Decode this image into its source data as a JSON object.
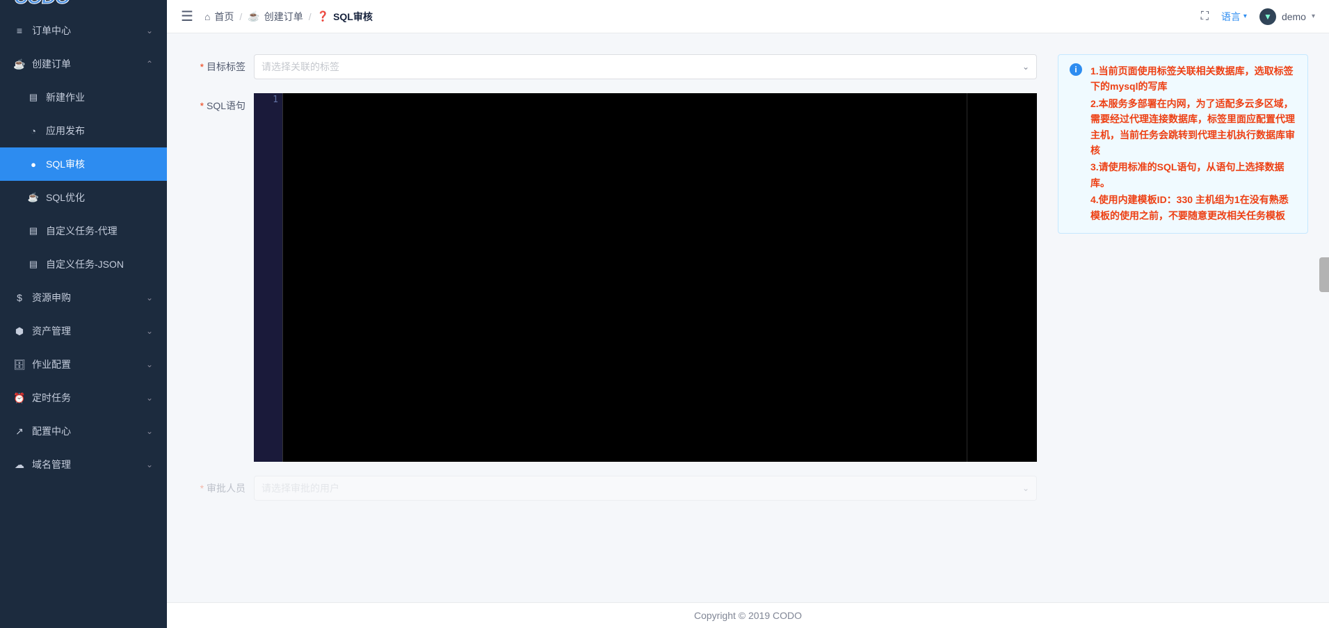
{
  "logo": "CODO",
  "sidebar": {
    "items": [
      {
        "label": "订单中心",
        "icon": "≡",
        "expandable": true,
        "open": false
      },
      {
        "label": "创建订单",
        "icon": "☕",
        "expandable": true,
        "open": true,
        "children": [
          {
            "label": "新建作业",
            "icon": "📋"
          },
          {
            "label": "应用发布",
            "icon": "◔"
          },
          {
            "label": "SQL审核",
            "icon": "●",
            "active": true
          },
          {
            "label": "SQL优化",
            "icon": "☕"
          },
          {
            "label": "自定义任务-代理",
            "icon": "📋"
          },
          {
            "label": "自定义任务-JSON",
            "icon": "📋"
          }
        ]
      },
      {
        "label": "资源申购",
        "icon": "$",
        "expandable": true,
        "open": false
      },
      {
        "label": "资产管理",
        "icon": "⬣",
        "expandable": true,
        "open": false
      },
      {
        "label": "作业配置",
        "icon": "🗄",
        "expandable": true,
        "open": false
      },
      {
        "label": "定时任务",
        "icon": "⏰",
        "expandable": true,
        "open": false
      },
      {
        "label": "配置中心",
        "icon": "↗",
        "expandable": true,
        "open": false
      },
      {
        "label": "域名管理",
        "icon": "☁",
        "expandable": true,
        "open": false
      }
    ]
  },
  "breadcrumb": {
    "home_label": "首页",
    "mid_label": "创建订单",
    "current_label": "SQL审核"
  },
  "header": {
    "language_label": "语言",
    "username": "demo"
  },
  "form": {
    "target_tag_label": "目标标签",
    "target_tag_placeholder": "请选择关联的标签",
    "sql_label": "SQL语句",
    "editor_line1": "1",
    "approver_label": "审批人员",
    "approver_placeholder": "请选择审批的用户"
  },
  "alert": {
    "line1": "1.当前页面使用标签关联相关数据库，选取标签下的mysql的写库",
    "line2": "2.本服务多部署在内网，为了适配多云多区域，需要经过代理连接数据库，标签里面应配置代理主机，当前任务会跳转到代理主机执行数据库审核",
    "line3": "3.请使用标准的SQL语句，从语句上选择数据库。",
    "line4": "4.使用内建模板ID：330 主机组为1在没有熟悉模板的使用之前，不要随意更改相关任务模板"
  },
  "footer": "Copyright © 2019 CODO"
}
